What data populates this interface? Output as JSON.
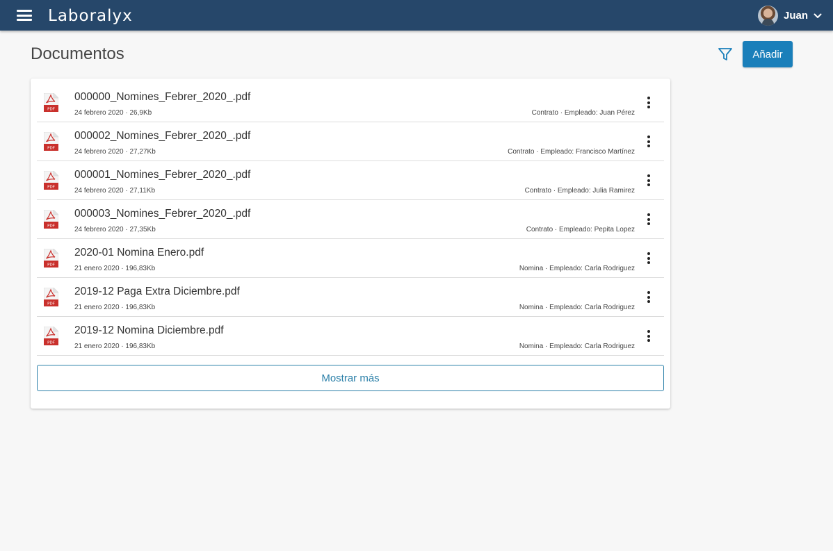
{
  "header": {
    "brand": "Laboralyx",
    "user_name": "Juan"
  },
  "page": {
    "title": "Documentos",
    "add_label": "Añadir",
    "show_more_label": "Mostrar más"
  },
  "documents": [
    {
      "name": "000000_Nomines_Febrer_2020_.pdf",
      "meta": "24 febrero 2020 · 26,9Kb",
      "tag": "Contrato · Empleado: Juan Pérez"
    },
    {
      "name": "000002_Nomines_Febrer_2020_.pdf",
      "meta": "24 febrero 2020 · 27,27Kb",
      "tag": "Contrato · Empleado: Francisco Martínez"
    },
    {
      "name": "000001_Nomines_Febrer_2020_.pdf",
      "meta": "24 febrero 2020 · 27,11Kb",
      "tag": "Contrato · Empleado: Julia Ramirez"
    },
    {
      "name": "000003_Nomines_Febrer_2020_.pdf",
      "meta": "24 febrero 2020 · 27,35Kb",
      "tag": "Contrato · Empleado: Pepita Lopez"
    },
    {
      "name": "2020-01 Nomina Enero.pdf",
      "meta": "21 enero 2020 · 196,83Kb",
      "tag": "Nomina · Empleado: Carla Rodriguez"
    },
    {
      "name": "2019-12 Paga Extra Diciembre.pdf",
      "meta": "21 enero 2020 · 196,83Kb",
      "tag": "Nomina · Empleado: Carla Rodriguez"
    },
    {
      "name": "2019-12 Nomina Diciembre.pdf",
      "meta": "21 enero 2020 · 196,83Kb",
      "tag": "Nomina · Empleado: Carla Rodriguez"
    }
  ],
  "icons": {
    "menu": "hamburger-icon",
    "filter": "filter-icon",
    "file": "pdf-file-icon",
    "row_actions": "more-vertical-icon",
    "user_menu": "chevron-down-icon"
  },
  "colors": {
    "header_bg": "#26476a",
    "primary": "#1a7fba",
    "pdf_red": "#c9302c"
  }
}
